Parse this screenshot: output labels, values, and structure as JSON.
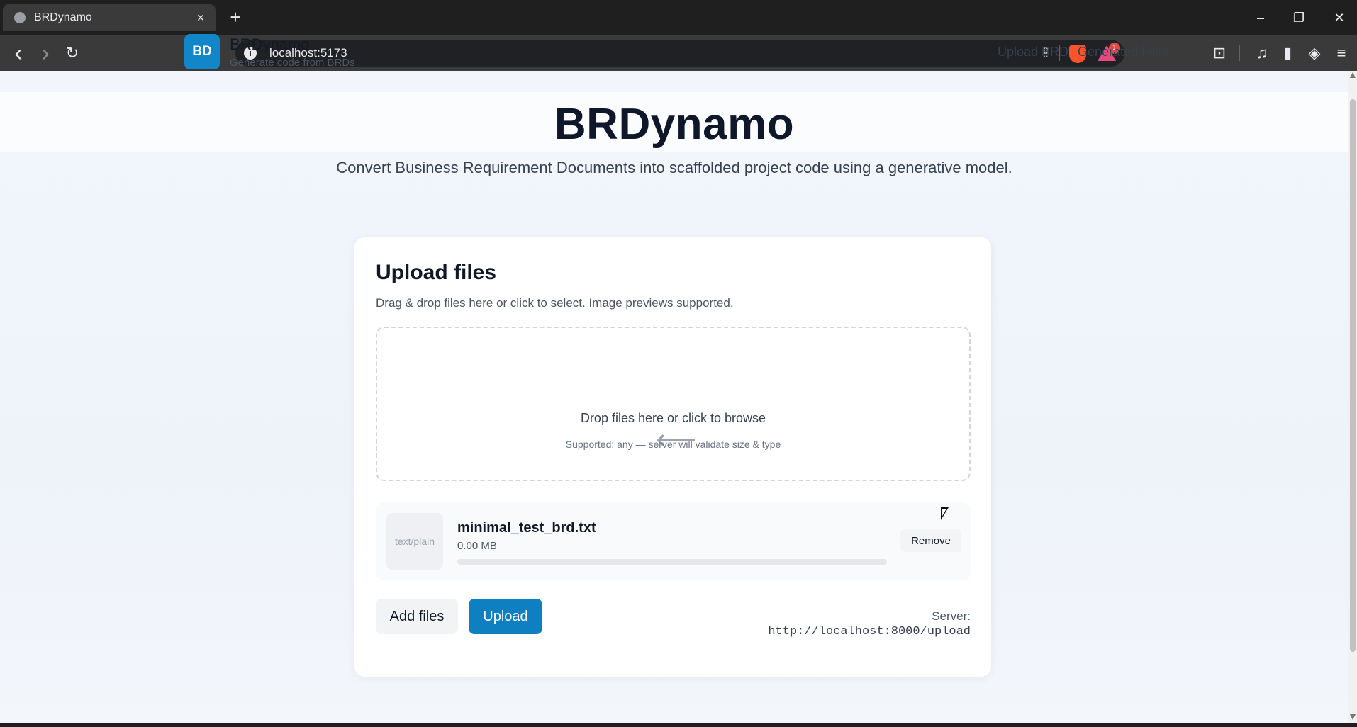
{
  "browser": {
    "tab_title": "BRDynamo",
    "tab_close": "×",
    "new_tab": "+",
    "url": "localhost:5173",
    "back": "‹",
    "forward": "›",
    "reload": "↻",
    "bookmark": "☆",
    "info": "i",
    "share": "⇪",
    "rewards_badge": "1",
    "window": {
      "minimize": "–",
      "restore": "❐",
      "close": "✕"
    },
    "toolbar_icons": {
      "media": "♫",
      "sidebar": "▮",
      "vpn": "◈",
      "menu": "≡",
      "reader": "⊡"
    }
  },
  "header": {
    "logo": "BD",
    "brand": "BRDynamo",
    "brand_sub": "Generate code from BRDs",
    "nav": [
      "Upload BRD",
      "Generated Files"
    ]
  },
  "hero": {
    "title": "BRDynamo",
    "subtitle": "Convert Business Requirement Documents into scaffolded project code using a generative model."
  },
  "upload": {
    "title": "Upload files",
    "subtitle": "Drag & drop files here or click to select. Image previews supported.",
    "drop_arrow": "⟵",
    "drop_main": "Drop files here or click to browse",
    "drop_note": "Supported: any — server will validate size & type",
    "file": {
      "thumb": "text/plain",
      "name": "minimal_test_brd.txt",
      "size": "0.00 MB",
      "progress": 0,
      "remove": "Remove"
    },
    "add_files": "Add files",
    "upload": "Upload",
    "server_label": "Server:",
    "server_url": "http://localhost:8000/upload"
  },
  "colors": {
    "accent": "#0e7fc0",
    "logo_bg": "#1187c9"
  }
}
